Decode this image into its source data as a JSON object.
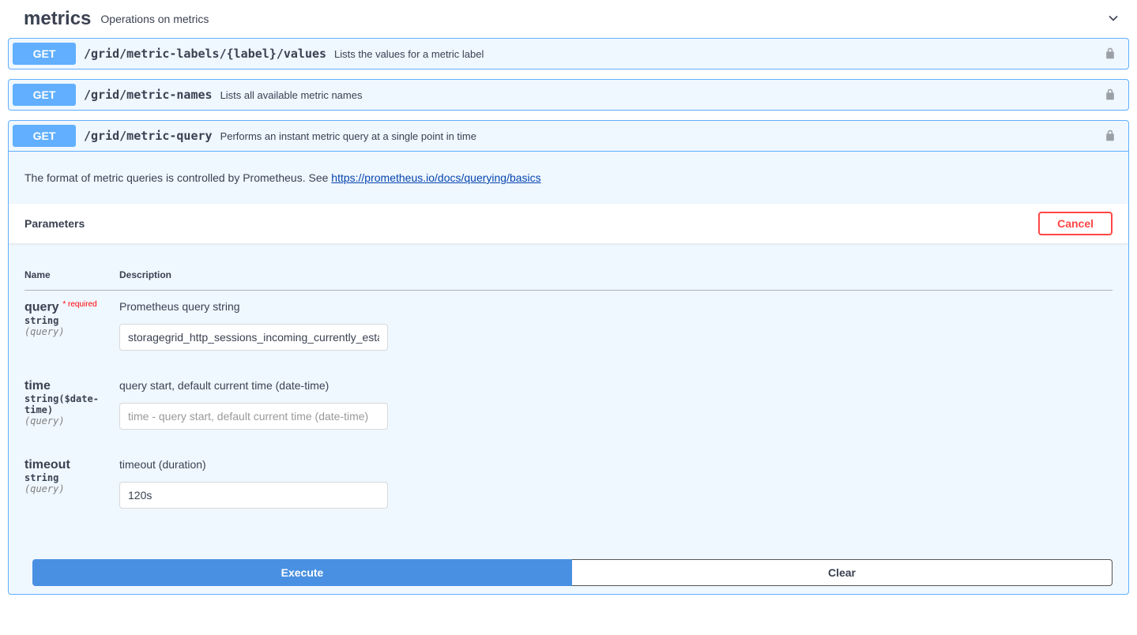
{
  "section": {
    "name": "metrics",
    "description": "Operations on metrics"
  },
  "endpoints": [
    {
      "method": "GET",
      "path": "/grid/metric-labels/{label}/values",
      "summary": "Lists the values for a metric label"
    },
    {
      "method": "GET",
      "path": "/grid/metric-names",
      "summary": "Lists all available metric names"
    },
    {
      "method": "GET",
      "path": "/grid/metric-query",
      "summary": "Performs an instant metric query at a single point in time"
    }
  ],
  "expanded": {
    "description_prefix": "The format of metric queries is controlled by Prometheus. See ",
    "description_link_text": "https://prometheus.io/docs/querying/basics",
    "description_link_href": "https://prometheus.io/docs/querying/basics",
    "parameters_label": "Parameters",
    "cancel_label": "Cancel",
    "columns": {
      "name": "Name",
      "description": "Description"
    },
    "required_label": "required",
    "params": [
      {
        "name": "query",
        "required": true,
        "type": "string",
        "in": "(query)",
        "description": "Prometheus query string",
        "value": "storagegrid_http_sessions_incoming_currently_established",
        "placeholder": ""
      },
      {
        "name": "time",
        "required": false,
        "type": "string($date-time)",
        "in": "(query)",
        "description": "query start, default current time (date-time)",
        "value": "",
        "placeholder": "time - query start, default current time (date-time)"
      },
      {
        "name": "timeout",
        "required": false,
        "type": "string",
        "in": "(query)",
        "description": "timeout (duration)",
        "value": "120s",
        "placeholder": ""
      }
    ],
    "execute_label": "Execute",
    "clear_label": "Clear"
  }
}
